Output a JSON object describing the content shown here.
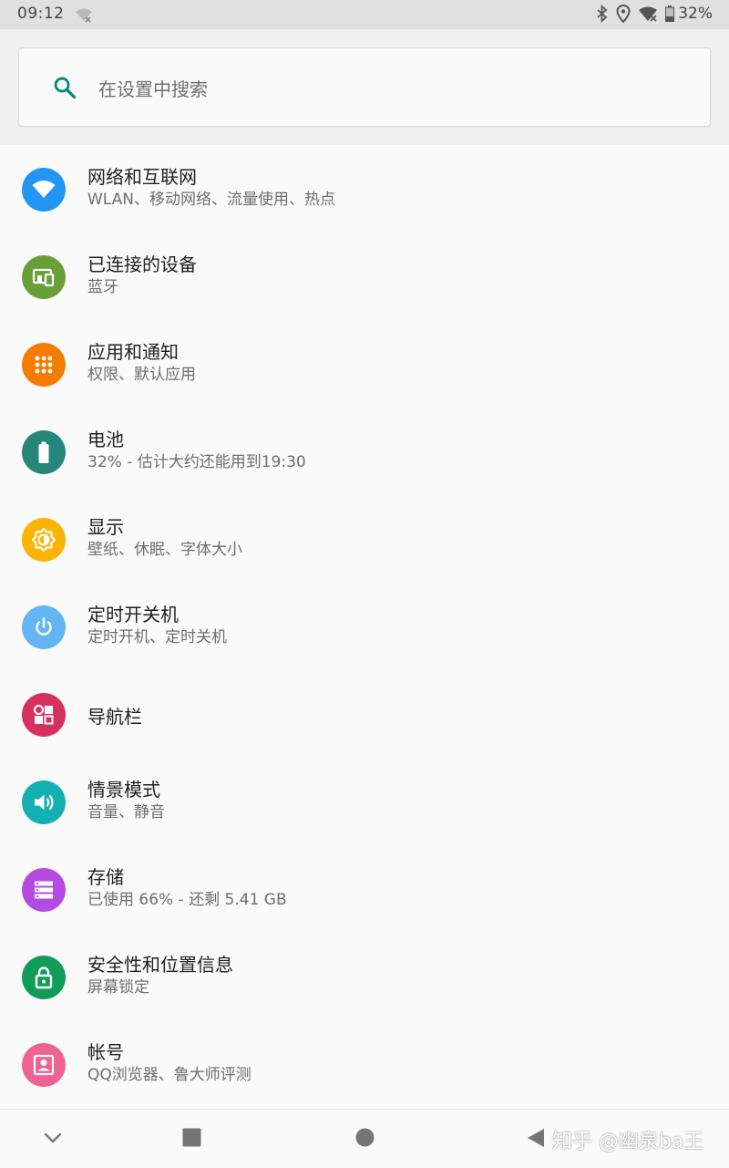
{
  "status_bar": {
    "time": "09:12",
    "battery_percent": "32%"
  },
  "search": {
    "placeholder": "在设置中搜索"
  },
  "settings": [
    {
      "title": "网络和互联网",
      "subtitle": "WLAN、移动网络、流量使用、热点",
      "icon": "wifi-icon",
      "color": "#2196f3"
    },
    {
      "title": "已连接的设备",
      "subtitle": "蓝牙",
      "icon": "devices-icon",
      "color": "#689f38"
    },
    {
      "title": "应用和通知",
      "subtitle": "权限、默认应用",
      "icon": "apps-grid-icon",
      "color": "#f57c00"
    },
    {
      "title": "电池",
      "subtitle": "32% - 估计大约还能用到19:30",
      "icon": "battery-icon",
      "color": "#26867a"
    },
    {
      "title": "显示",
      "subtitle": "壁纸、休眠、字体大小",
      "icon": "brightness-icon",
      "color": "#fbb400"
    },
    {
      "title": "定时开关机",
      "subtitle": "定时开机、定时关机",
      "icon": "power-icon",
      "color": "#64b5f6"
    },
    {
      "title": "导航栏",
      "subtitle": "",
      "icon": "navigation-bar-icon",
      "color": "#d6305f"
    },
    {
      "title": "情景模式",
      "subtitle": "音量、静音",
      "icon": "volume-icon",
      "color": "#12b0b0"
    },
    {
      "title": "存储",
      "subtitle": "已使用 66% - 还剩 5.41 GB",
      "icon": "storage-icon",
      "color": "#b44be1"
    },
    {
      "title": "安全性和位置信息",
      "subtitle": "屏幕锁定",
      "icon": "lock-icon",
      "color": "#109d58"
    },
    {
      "title": "帐号",
      "subtitle": "QQ浏览器、鲁大师评测",
      "icon": "account-icon",
      "color": "#f06292"
    }
  ],
  "nav_bar": {
    "watermark": "知乎 @幽泉ba王"
  }
}
